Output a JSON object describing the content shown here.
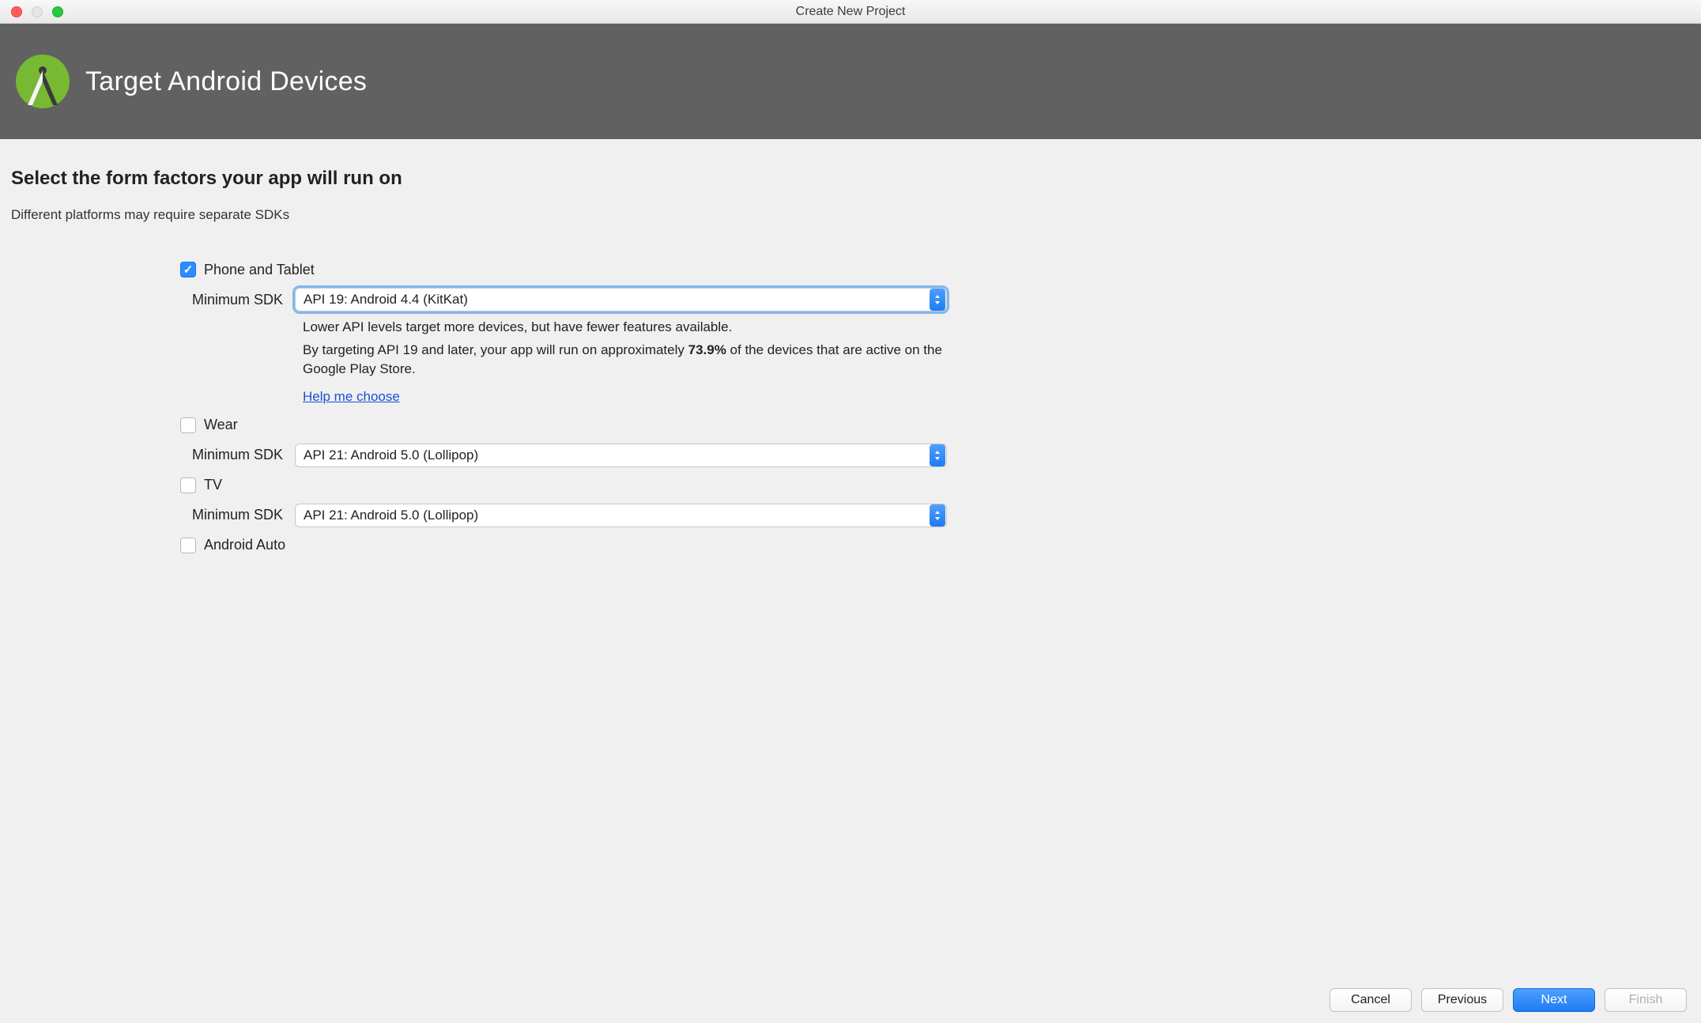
{
  "titlebar": {
    "title": "Create New Project"
  },
  "banner": {
    "title": "Target Android Devices"
  },
  "main": {
    "heading": "Select the form factors your app will run on",
    "subheading": "Different platforms may require separate SDKs",
    "sdk_label": "Minimum SDK",
    "hint_line1": "Lower API levels target more devices, but have fewer features available.",
    "hint_line2_pre": "By targeting API 19 and later, your app will run on approximately ",
    "hint_pct": "73.9%",
    "hint_line2_post": " of the devices that are active on the Google Play Store.",
    "help_link": "Help me choose",
    "factors": {
      "phone": {
        "label": "Phone and Tablet",
        "checked": true,
        "sdk": "API 19: Android 4.4 (KitKat)"
      },
      "wear": {
        "label": "Wear",
        "checked": false,
        "sdk": "API 21: Android 5.0 (Lollipop)"
      },
      "tv": {
        "label": "TV",
        "checked": false,
        "sdk": "API 21: Android 5.0 (Lollipop)"
      },
      "auto": {
        "label": "Android Auto",
        "checked": false
      }
    }
  },
  "footer": {
    "cancel": "Cancel",
    "previous": "Previous",
    "next": "Next",
    "finish": "Finish"
  }
}
